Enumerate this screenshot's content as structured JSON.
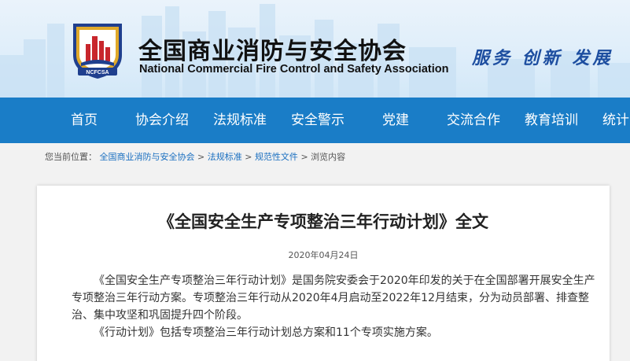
{
  "header": {
    "org_name_cn": "全国商业消防与安全协会",
    "org_name_en": "National Commercial Fire Control and Safety Association",
    "logo_text": "NCFCSA",
    "slogan": "服务 创新 发展"
  },
  "nav": {
    "items": [
      {
        "label": "首页"
      },
      {
        "label": "协会介绍"
      },
      {
        "label": "法规标准"
      },
      {
        "label": "安全警示"
      },
      {
        "label": "党建"
      },
      {
        "label": "交流合作"
      },
      {
        "label": "教育培训"
      },
      {
        "label": "统计"
      }
    ]
  },
  "breadcrumb": {
    "prefix": "您当前位置：",
    "links": [
      "全国商业消防与安全协会",
      "法规标准",
      "规范性文件"
    ],
    "current": "浏览内容",
    "separator": ">"
  },
  "article": {
    "title": "《全国安全生产专项整治三年行动计划》全文",
    "date": "2020年04月24日",
    "paragraphs": [
      "《全国安全生产专项整治三年行动计划》是国务院安委会于2020年印发的关于在全国部署开展安全生产专项整治三年行动方案。专项整治三年行动从2020年4月启动至2022年12月结束，分为动员部署、排查整治、集中攻坚和巩固提升四个阶段。",
      "《行动计划》包括专项整治三年行动计划总方案和11个专项实施方案。"
    ]
  },
  "colors": {
    "nav_bg": "#1a7dc7",
    "slogan": "#1d4ea0",
    "link": "#1a6fc0",
    "logo_red": "#c8262c",
    "logo_blue": "#1f3f8e",
    "logo_gold": "#e0a92a"
  },
  "icons": {
    "logo": "association-emblem"
  }
}
